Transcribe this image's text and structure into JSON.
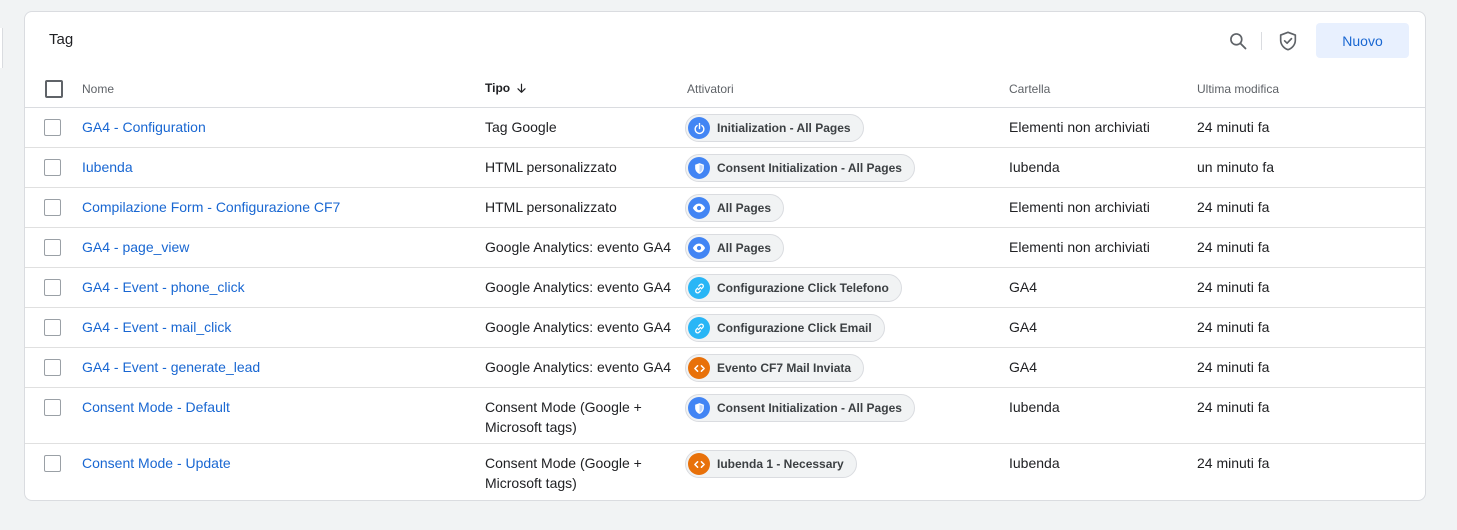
{
  "header": {
    "title": "Tag",
    "new_button": "Nuovo"
  },
  "columns": {
    "name": "Nome",
    "type": "Tipo",
    "triggers": "Attivatori",
    "folder": "Cartella",
    "modified": "Ultima modifica"
  },
  "rows": [
    {
      "name": "GA4 - Configuration",
      "type": "Tag Google",
      "trigger": "Initialization - All Pages",
      "trigger_icon": "power-icon",
      "trigger_color": "#4285f4",
      "folder": "Elementi non archiviati",
      "modified": "24 minuti fa"
    },
    {
      "name": "Iubenda",
      "type": "HTML personalizzato",
      "trigger": "Consent Initialization - All Pages",
      "trigger_icon": "shield-icon",
      "trigger_color": "#4285f4",
      "folder": "Iubenda",
      "modified": "un minuto fa"
    },
    {
      "name": "Compilazione Form - Configurazione CF7",
      "type": "HTML personalizzato",
      "trigger": "All Pages",
      "trigger_icon": "eye-icon",
      "trigger_color": "#4285f4",
      "folder": "Elementi non archiviati",
      "modified": "24 minuti fa"
    },
    {
      "name": "GA4 - page_view",
      "type": "Google Analytics: evento GA4",
      "trigger": "All Pages",
      "trigger_icon": "eye-icon",
      "trigger_color": "#4285f4",
      "folder": "Elementi non archiviati",
      "modified": "24 minuti fa"
    },
    {
      "name": "GA4 - Event - phone_click",
      "type": "Google Analytics: evento GA4",
      "trigger": "Configurazione Click Telefono",
      "trigger_icon": "link-icon",
      "trigger_color": "#29b6f6",
      "folder": "GA4",
      "modified": "24 minuti fa"
    },
    {
      "name": "GA4 - Event - mail_click",
      "type": "Google Analytics: evento GA4",
      "trigger": "Configurazione Click Email",
      "trigger_icon": "link-icon",
      "trigger_color": "#29b6f6",
      "folder": "GA4",
      "modified": "24 minuti fa"
    },
    {
      "name": "GA4 - Event - generate_lead",
      "type": "Google Analytics: evento GA4",
      "trigger": "Evento CF7 Mail Inviata",
      "trigger_icon": "code-icon",
      "trigger_color": "#e8710a",
      "folder": "GA4",
      "modified": "24 minuti fa"
    },
    {
      "name": "Consent Mode - Default",
      "type": "Consent Mode (Google + Microsoft tags)",
      "trigger": "Consent Initialization - All Pages",
      "trigger_icon": "shield-icon",
      "trigger_color": "#4285f4",
      "folder": "Iubenda",
      "modified": "24 minuti fa"
    },
    {
      "name": "Consent Mode - Update",
      "type": "Consent Mode (Google + Microsoft tags)",
      "trigger": "Iubenda 1 - Necessary",
      "trigger_icon": "code-icon",
      "trigger_color": "#e8710a",
      "folder": "Iubenda",
      "modified": "24 minuti fa"
    }
  ]
}
